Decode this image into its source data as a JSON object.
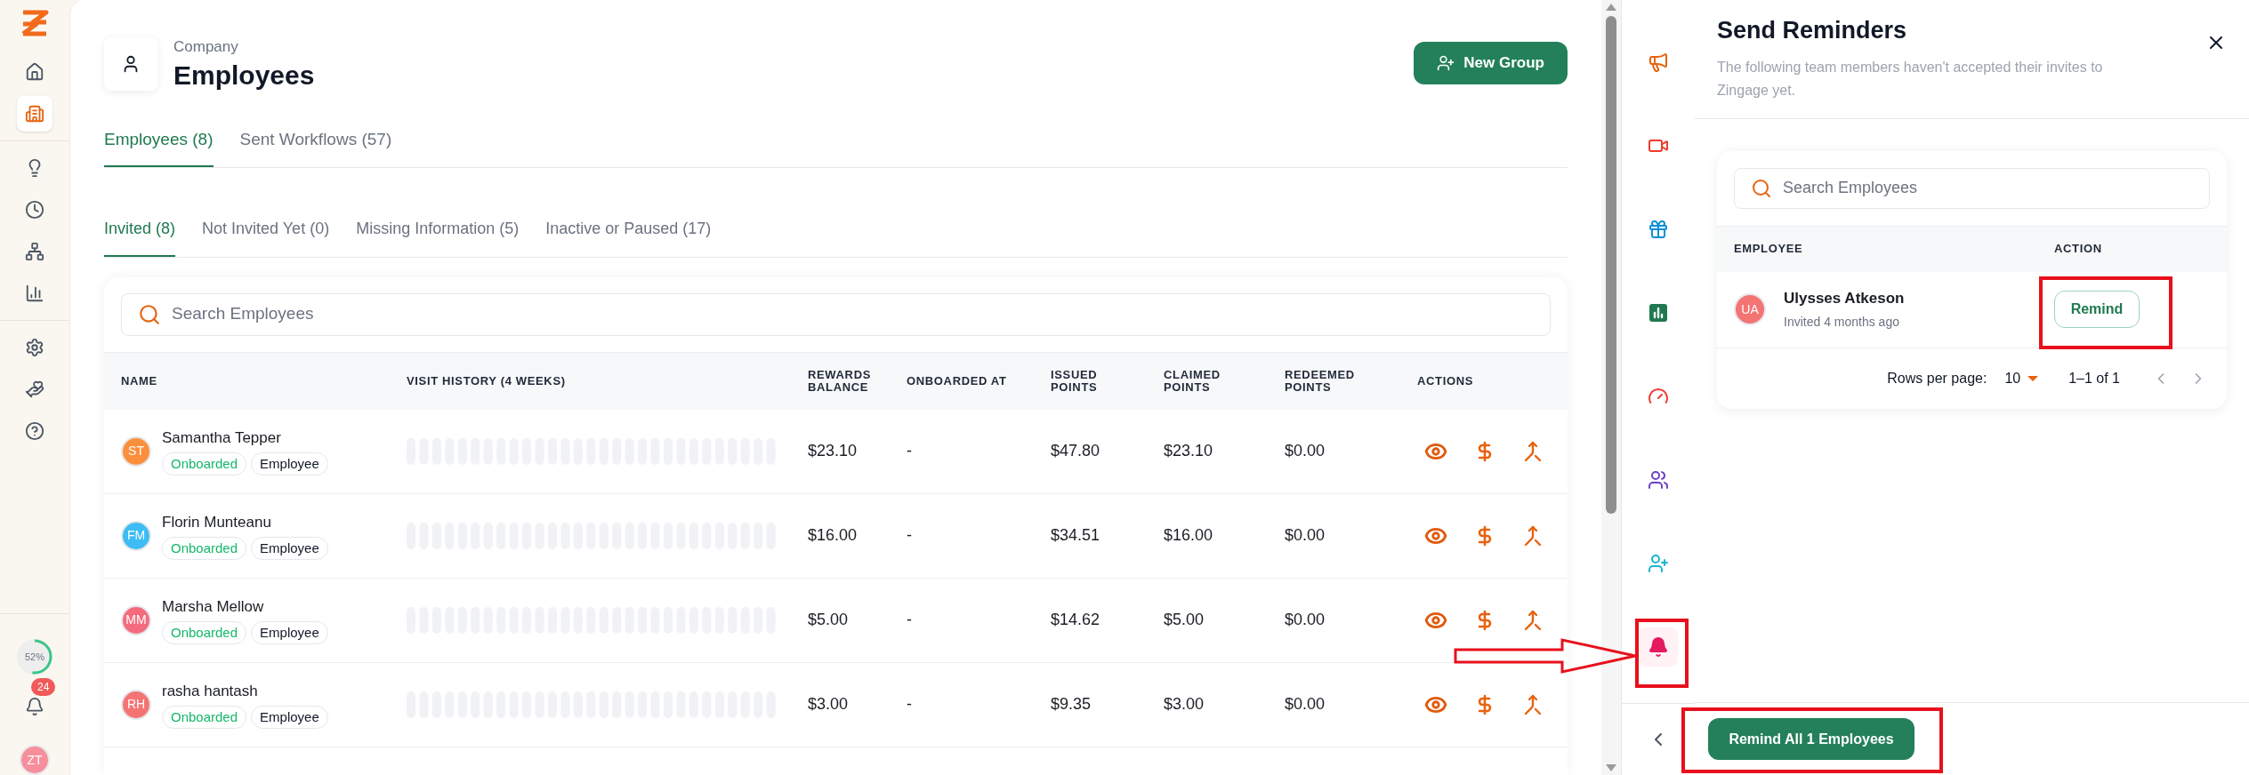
{
  "nav": {
    "items": [
      {
        "selected": false
      },
      {
        "selected": true
      },
      {
        "selected": false
      },
      {
        "selected": false
      },
      {
        "selected": false
      },
      {
        "selected": false
      },
      {
        "selected": false
      },
      {
        "selected": false
      },
      {
        "selected": false
      }
    ],
    "progress": {
      "label": "52%",
      "level": 0.52
    },
    "notification_count": "24",
    "user_initials": "ZT"
  },
  "header": {
    "breadcrumb": "Company",
    "title": "Employees",
    "button": "New Group"
  },
  "tabs": [
    {
      "label": "Employees (8)",
      "selected": true
    },
    {
      "label": "Sent Workflows (57)",
      "selected": false
    }
  ],
  "subtabs": [
    {
      "label": "Invited (8)",
      "selected": true
    },
    {
      "label": "Not Invited Yet (0)",
      "selected": false
    },
    {
      "label": "Missing Information (5)",
      "selected": false
    },
    {
      "label": "Inactive or Paused (17)",
      "selected": false
    }
  ],
  "search": {
    "placeholder": "Search Employees"
  },
  "table": {
    "columns": [
      "NAME",
      "VISIT HISTORY (4 WEEKS)",
      "REWARDS BALANCE",
      "ONBOARDED AT",
      "ISSUED POINTS",
      "CLAIMED POINTS",
      "REDEEMED POINTS",
      "ACTIONS"
    ],
    "rows": [
      {
        "initials": "ST",
        "color": "#fb8f3c",
        "name": "Samantha Tepper",
        "status": "Onboarded",
        "role": "Employee",
        "rewards_balance": "$23.10",
        "onboarded_at": "-",
        "issued_points": "$47.80",
        "claimed_points": "$23.10",
        "redeemed_points": "$0.00"
      },
      {
        "initials": "FM",
        "color": "#3dbcf5",
        "name": "Florin Munteanu",
        "status": "Onboarded",
        "role": "Employee",
        "rewards_balance": "$16.00",
        "onboarded_at": "-",
        "issued_points": "$34.51",
        "claimed_points": "$16.00",
        "redeemed_points": "$0.00"
      },
      {
        "initials": "MM",
        "color": "#f56b7e",
        "name": "Marsha Mellow",
        "status": "Onboarded",
        "role": "Employee",
        "rewards_balance": "$5.00",
        "onboarded_at": "-",
        "issued_points": "$14.62",
        "claimed_points": "$5.00",
        "redeemed_points": "$0.00"
      },
      {
        "initials": "RH",
        "color": "#f47474",
        "name": "rasha hantash",
        "status": "Onboarded",
        "role": "Employee",
        "rewards_balance": "$3.00",
        "onboarded_at": "-",
        "issued_points": "$9.35",
        "claimed_points": "$3.00",
        "redeemed_points": "$0.00"
      }
    ]
  },
  "rail": {
    "items": [
      {
        "selected": false
      },
      {
        "selected": false
      },
      {
        "selected": false
      },
      {
        "selected": false
      },
      {
        "selected": false
      },
      {
        "selected": false
      },
      {
        "selected": false
      },
      {
        "selected": true
      }
    ]
  },
  "panel": {
    "title": "Send Reminders",
    "subtitle": "The following team members haven't accepted their invites to Zingage yet.",
    "search_placeholder": "Search Employees",
    "columns": [
      "EMPLOYEE",
      "ACTION"
    ],
    "rows": [
      {
        "initials": "UA",
        "color": "#f47474",
        "name": "Ulysses Atkeson",
        "invited": "Invited 4 months ago",
        "action": "Remind"
      }
    ],
    "rows_per_page_label": "Rows per page:",
    "rows_per_page": "10",
    "range": "1–1 of 1",
    "button": "Remind All 1 Employees"
  }
}
